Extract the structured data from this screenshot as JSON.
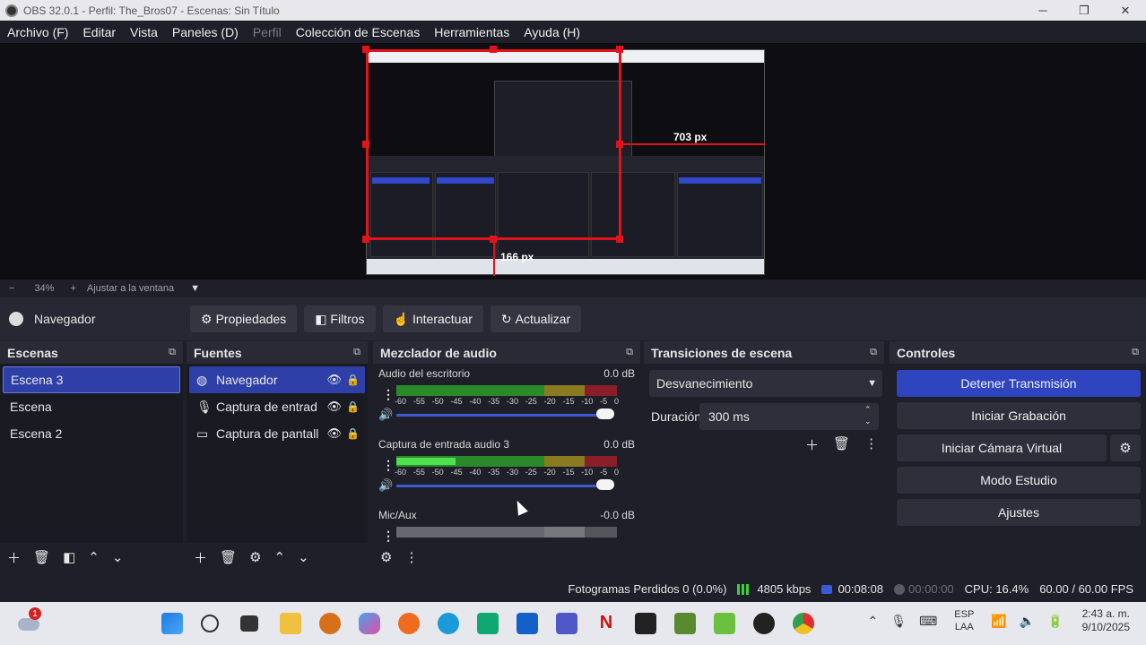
{
  "window": {
    "title": "OBS 32.0.1 - Perfil: The_Bros07 - Escenas: Sin Título",
    "minimize": "─",
    "maximize": "❐",
    "close": "✕"
  },
  "menu": [
    {
      "label": "Archivo (F)",
      "disabled": false
    },
    {
      "label": "Editar",
      "disabled": false
    },
    {
      "label": "Vista",
      "disabled": false
    },
    {
      "label": "Paneles (D)",
      "disabled": false
    },
    {
      "label": "Perfil",
      "disabled": true
    },
    {
      "label": "Colección de Escenas",
      "disabled": false
    },
    {
      "label": "Herramientas",
      "disabled": false
    },
    {
      "label": "Ayuda (H)",
      "disabled": false
    }
  ],
  "preview": {
    "width_label": "703 px",
    "height_label": "166 px"
  },
  "zoom": {
    "minus": "−",
    "level": "34%",
    "plus": "+",
    "fit_label": "Ajustar a la ventana",
    "dropdown": "▼"
  },
  "source_toolbar": {
    "source_name": "Navegador",
    "properties": "Propiedades",
    "filters": "Filtros",
    "interact": "Interactuar",
    "refresh": "Actualizar"
  },
  "scenes": {
    "title": "Escenas",
    "items": [
      "Escena 3",
      "Escena",
      "Escena 2"
    ],
    "active_index": 0
  },
  "sources": {
    "title": "Fuentes",
    "items": [
      {
        "label": "Navegador",
        "icon": "globe-icon"
      },
      {
        "label": "Captura de entrad",
        "icon": "microphone-icon"
      },
      {
        "label": "Captura de pantall",
        "icon": "monitor-icon"
      }
    ],
    "active_index": 0
  },
  "mixer": {
    "title": "Mezclador de audio",
    "tracks": [
      {
        "name": "Audio del escritorio",
        "db": "0.0 dB",
        "level": 0.0
      },
      {
        "name": "Captura de entrada audio 3",
        "db": "0.0 dB",
        "level": 0.27
      },
      {
        "name": "Mic/Aux",
        "db": "-0.0 dB",
        "level": 0.0
      }
    ],
    "ticks": [
      "-60",
      "-55",
      "-50",
      "-45",
      "-40",
      "-35",
      "-30",
      "-25",
      "-20",
      "-15",
      "-10",
      "-5",
      "0"
    ],
    "volume_level": 0.97
  },
  "transitions": {
    "title": "Transiciones de escena",
    "selected": "Desvanecimiento",
    "duration_label": "Duración",
    "duration_value": "300 ms"
  },
  "controls": {
    "title": "Controles",
    "stop_stream": "Detener Transmisión",
    "start_recording": "Iniciar Grabación",
    "virtual_cam": "Iniciar Cámara Virtual",
    "studio_mode": "Modo Estudio",
    "settings": "Ajustes"
  },
  "status": {
    "dropped_frames": "Fotogramas Perdidos 0 (0.0%)",
    "bitrate": "4805 kbps",
    "stream_time": "00:08:08",
    "rec_time": "00:00:00",
    "cpu": "CPU: 16.4%",
    "fps": "60.00 / 60.00 FPS"
  },
  "taskbar": {
    "weather_badge": "1",
    "lang_top": "ESP",
    "lang_bottom": "LAA",
    "time": "2:43 a. m.",
    "date": "9/10/2025"
  },
  "colors": {
    "accent": "#2f45c0",
    "selection": "#e2141b",
    "meter_green": "#2a8a2a",
    "meter_yellow": "#8a7a20",
    "meter_red": "#8a1f2a"
  }
}
